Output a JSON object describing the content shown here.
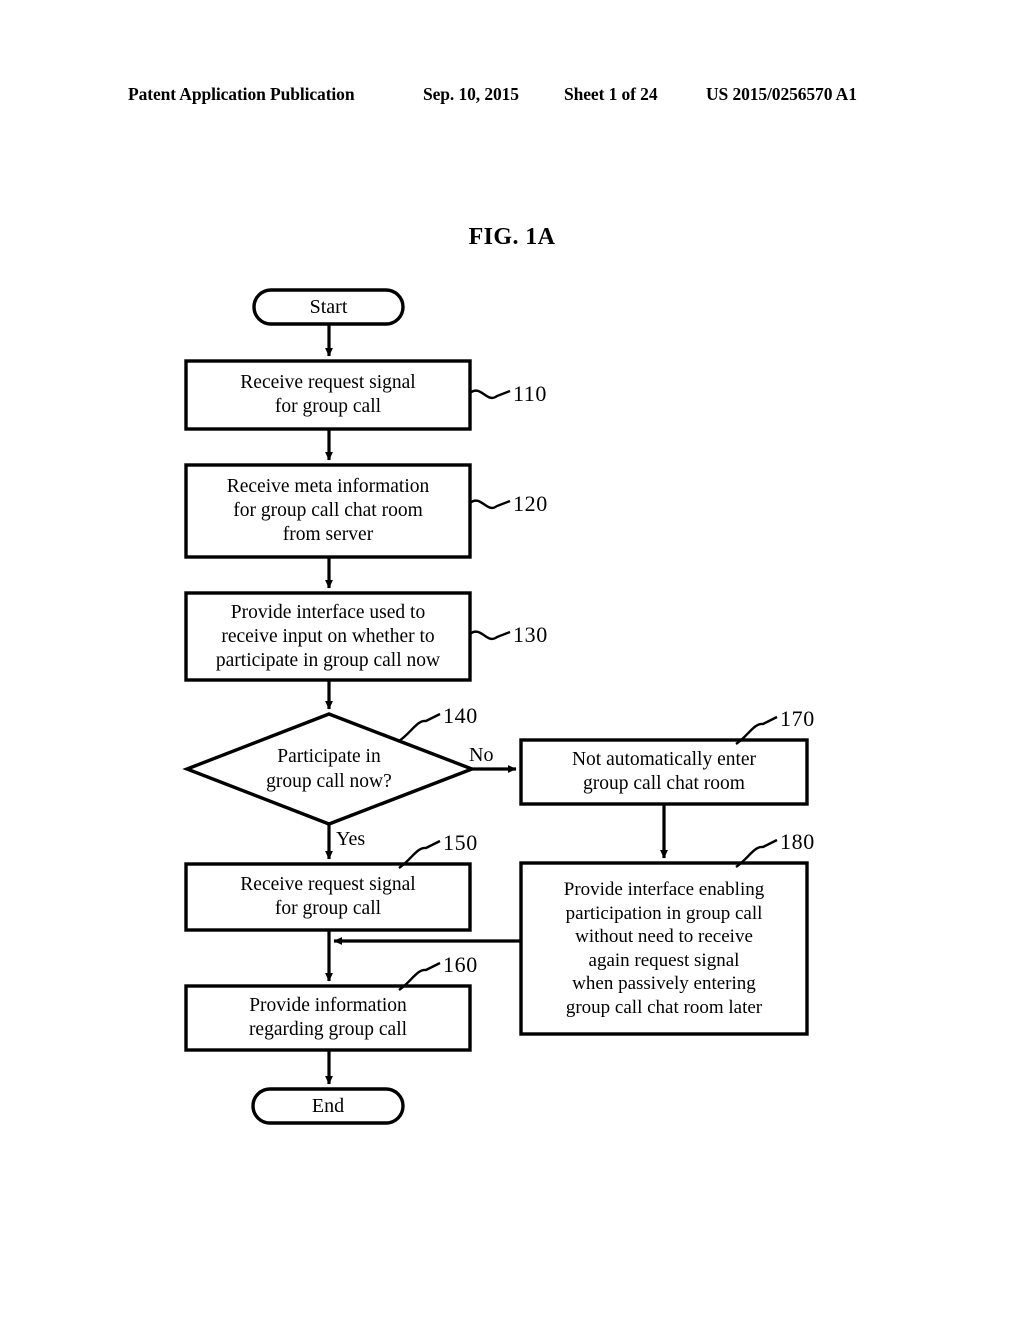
{
  "header": {
    "publication": "Patent Application Publication",
    "date": "Sep. 10, 2015",
    "sheet": "Sheet 1 of 24",
    "publication_number": "US 2015/0256570 A1"
  },
  "figure": {
    "title": "FIG. 1A",
    "type": "flowchart"
  },
  "flowchart": {
    "nodes": [
      {
        "id": "start",
        "shape": "terminal",
        "label": "Start",
        "ref": null
      },
      {
        "id": "step110",
        "shape": "process",
        "label": "Receive request signal\nfor group call",
        "ref": "110"
      },
      {
        "id": "step120",
        "shape": "process",
        "label": "Receive meta information\nfor group call chat room\nfrom server",
        "ref": "120"
      },
      {
        "id": "step130",
        "shape": "process",
        "label": "Provide interface used to\nreceive input on whether to\nparticipate in group call now",
        "ref": "130"
      },
      {
        "id": "step140",
        "shape": "decision",
        "label": "Participate in\ngroup call now?",
        "ref": "140"
      },
      {
        "id": "step150",
        "shape": "process",
        "label": "Receive request signal\nfor group call",
        "ref": "150"
      },
      {
        "id": "step160",
        "shape": "process",
        "label": "Provide information\nregarding group call",
        "ref": "160"
      },
      {
        "id": "step170",
        "shape": "process",
        "label": "Not automatically enter\ngroup call chat room",
        "ref": "170"
      },
      {
        "id": "step180",
        "shape": "process",
        "label": "Provide interface enabling\nparticipation in group call\nwithout need to receive\nagain request signal\nwhen passively entering\ngroup call chat room later",
        "ref": "180"
      },
      {
        "id": "end",
        "shape": "terminal",
        "label": "End",
        "ref": null
      }
    ],
    "branch_labels": {
      "yes": "Yes",
      "no": "No"
    },
    "ref_numbers": {
      "n110": "110",
      "n120": "120",
      "n130": "130",
      "n140": "140",
      "n150": "150",
      "n160": "160",
      "n170": "170",
      "n180": "180"
    },
    "colors": {
      "stroke": "#000000",
      "fill": "#ffffff",
      "text": "#000000"
    }
  }
}
